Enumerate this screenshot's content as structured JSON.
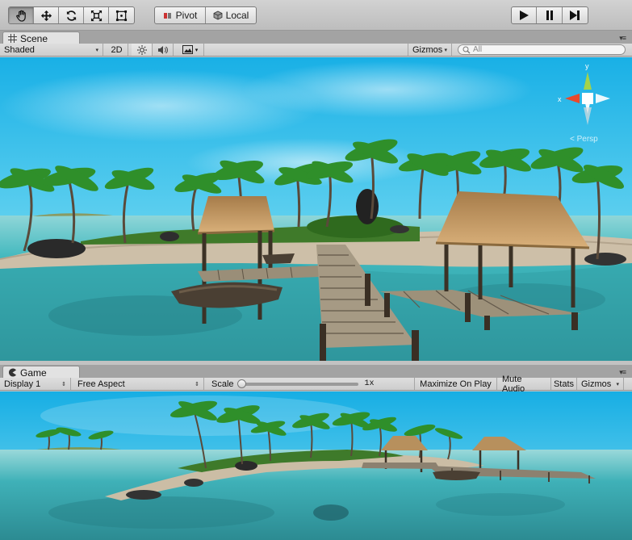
{
  "toolbar": {
    "tools": [
      {
        "name": "hand-tool-icon"
      },
      {
        "name": "move-tool-icon"
      },
      {
        "name": "rotate-tool-icon"
      },
      {
        "name": "scale-tool-icon"
      },
      {
        "name": "rect-tool-icon"
      }
    ],
    "pivot_label": "Pivot",
    "local_label": "Local"
  },
  "scene": {
    "tab_label": "Scene",
    "shading_mode": "Shaded",
    "mode_2d": "2D",
    "gizmos_label": "Gizmos",
    "search_placeholder": "All",
    "gizmo_axis_labels": {
      "x": "x",
      "y": "y"
    },
    "persp_label": "< Persp"
  },
  "game": {
    "tab_label": "Game",
    "display": "Display 1",
    "aspect": "Free Aspect",
    "scale_label": "Scale",
    "scale_value": "1x",
    "maximize_label": "Maximize On Play",
    "mute_label": "Mute Audio",
    "stats_label": "Stats",
    "gizmos_label": "Gizmos"
  },
  "colors": {
    "toolbar_bg": "#c8c8c8",
    "gizmo_x": "#e8492b",
    "gizmo_y": "#a4d34a",
    "sky_top": "#1fb4e6",
    "water": "#3fb7bd"
  }
}
